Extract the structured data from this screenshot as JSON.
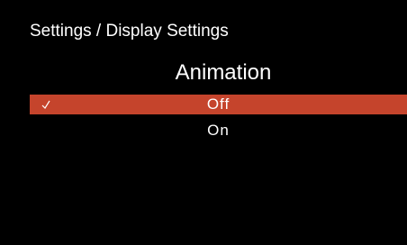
{
  "header": {
    "breadcrumb": "Settings / Display Settings"
  },
  "screen": {
    "title": "Animation"
  },
  "options": [
    {
      "label": "Off",
      "selected": true
    },
    {
      "label": "On",
      "selected": false
    }
  ],
  "icons": {
    "selected_marker": "checkmark-icon"
  },
  "colors": {
    "background": "#000000",
    "highlight": "#c5442c",
    "text": "#ffffff"
  }
}
